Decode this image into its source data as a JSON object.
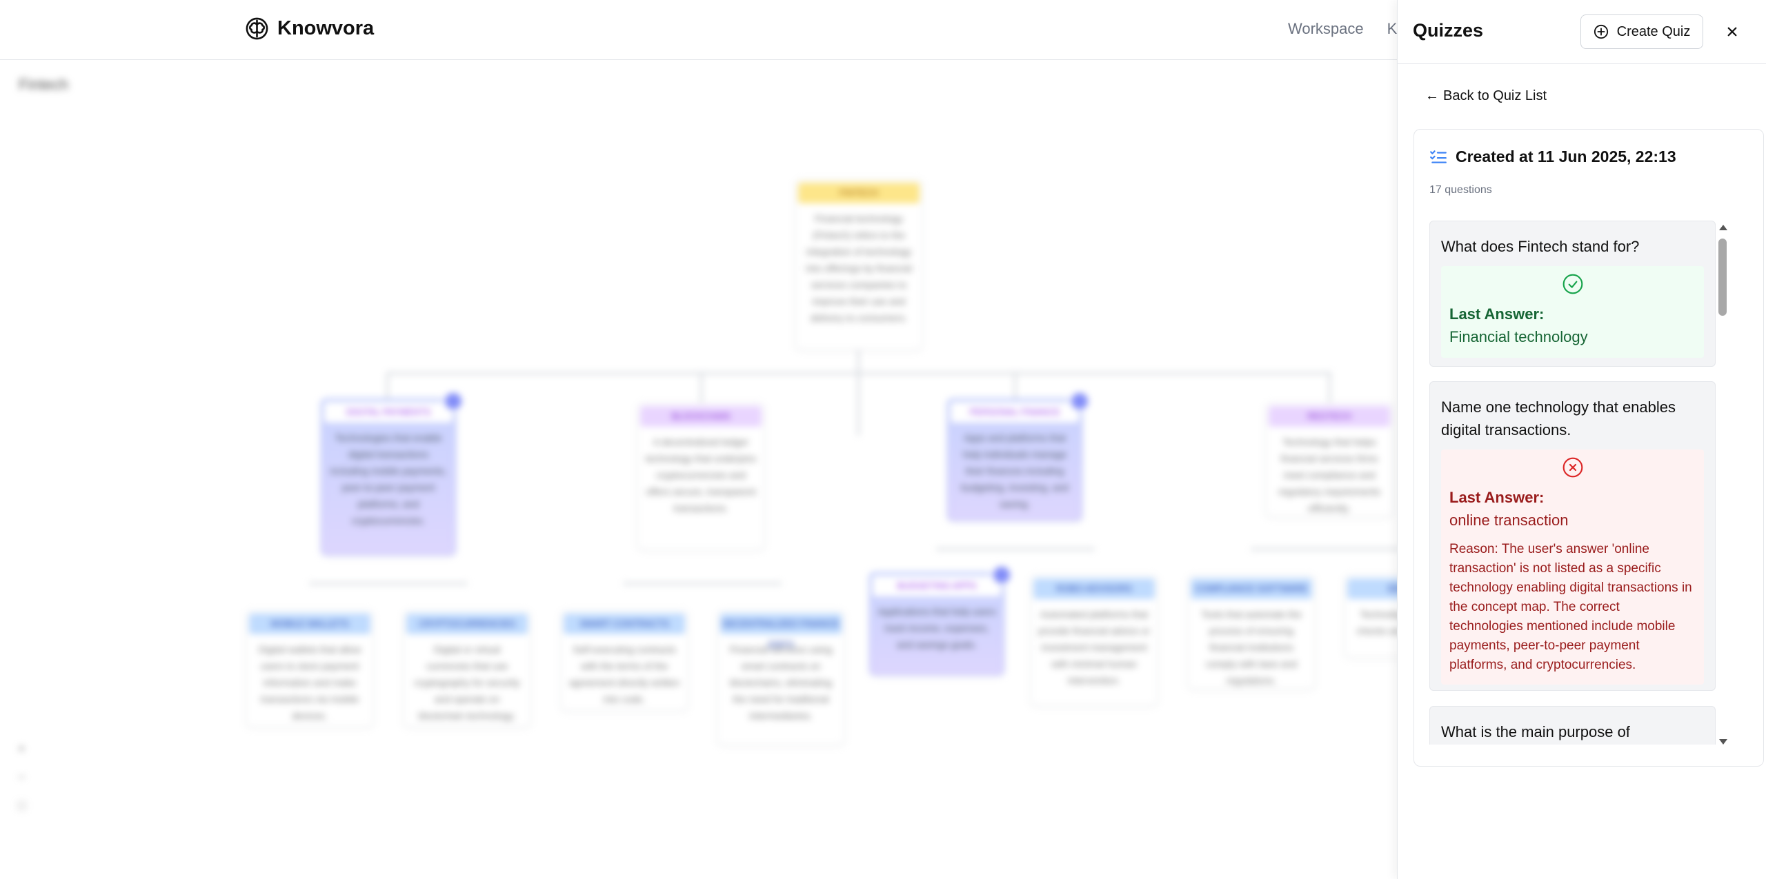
{
  "app": {
    "name": "Knowvora",
    "logo_icon": "brain-icon",
    "nav": [
      "Workspace",
      "K"
    ]
  },
  "canvas": {
    "breadcrumb": "Fintech",
    "nodes": [
      {
        "title": "Fintech",
        "body": "Financial technology (Fintech) refers to the integration of technology into offerings by financial services companies to improve their use and delivery to consumers."
      },
      {
        "title": "Digital Payments",
        "body": "Technologies that enable digital transactions including mobile payments, peer-to-peer payment platforms, and cryptocurrencies."
      },
      {
        "title": "Blockchain",
        "body": "A decentralized ledger technology that underpins cryptocurrencies and offers secure, transparent transactions."
      },
      {
        "title": "Personal Finance",
        "body": "Apps and platforms that help individuals manage their finances including budgeting, investing, and saving."
      },
      {
        "title": "RegTech",
        "body": "Technology that helps financial services firms meet compliance and regulatory requirements efficiently."
      },
      {
        "title": "Mobile Wallets",
        "body": "Digital wallets that allow users to store payment information and make transactions via mobile devices."
      },
      {
        "title": "Cryptocurrencies",
        "body": "Digital or virtual currencies that use cryptography for security and operate on blockchain technology."
      },
      {
        "title": "Smart Contracts",
        "body": "Self-executing contracts with the terms of the agreement directly written into code."
      },
      {
        "title": "Decentralized Finance (DeFi)",
        "body": "Financial services using smart contracts on blockchains, eliminating the need for traditional intermediaries."
      },
      {
        "title": "Budgeting Apps",
        "body": "Applications that help users track income, expenses, and savings goals."
      },
      {
        "title": "Robo-Advisors",
        "body": "Automated platforms that provide financial advice or investment management with minimal human intervention."
      },
      {
        "title": "Compliance Software",
        "body": "Tools that automate the process of ensuring financial institutions comply with laws and regulations."
      },
      {
        "title": "Identity",
        "body": "Technology for identity checks and onboarding."
      }
    ],
    "controls": [
      "+",
      "−",
      "□"
    ]
  },
  "panel": {
    "title": "Quizzes",
    "create_label": "Create Quiz",
    "back_label": "Back to Quiz List",
    "back_arrow": "←",
    "card_title": "Created at 11 Jun 2025, 22:13",
    "question_count": "17 questions",
    "questions": [
      {
        "text": "What does Fintech stand for?",
        "status": "correct",
        "answer_label": "Last Answer:",
        "answer": "Financial technology"
      },
      {
        "text": "Name one technology that enables digital transactions.",
        "status": "incorrect",
        "answer_label": "Last Answer:",
        "answer": "online transaction",
        "reason": "Reason: The user's answer 'online transaction' is not listed as a specific technology enabling digital transactions in the concept map. The correct technologies mentioned include mobile payments, peer-to-peer payment platforms, and cryptocurrencies."
      },
      {
        "text": "What is the main purpose of blockchain technology?"
      }
    ]
  },
  "colors": {
    "correct": "#166534",
    "correct_bg": "#f0fdf4",
    "incorrect": "#991b1b",
    "incorrect_bg": "#fef2f2"
  }
}
